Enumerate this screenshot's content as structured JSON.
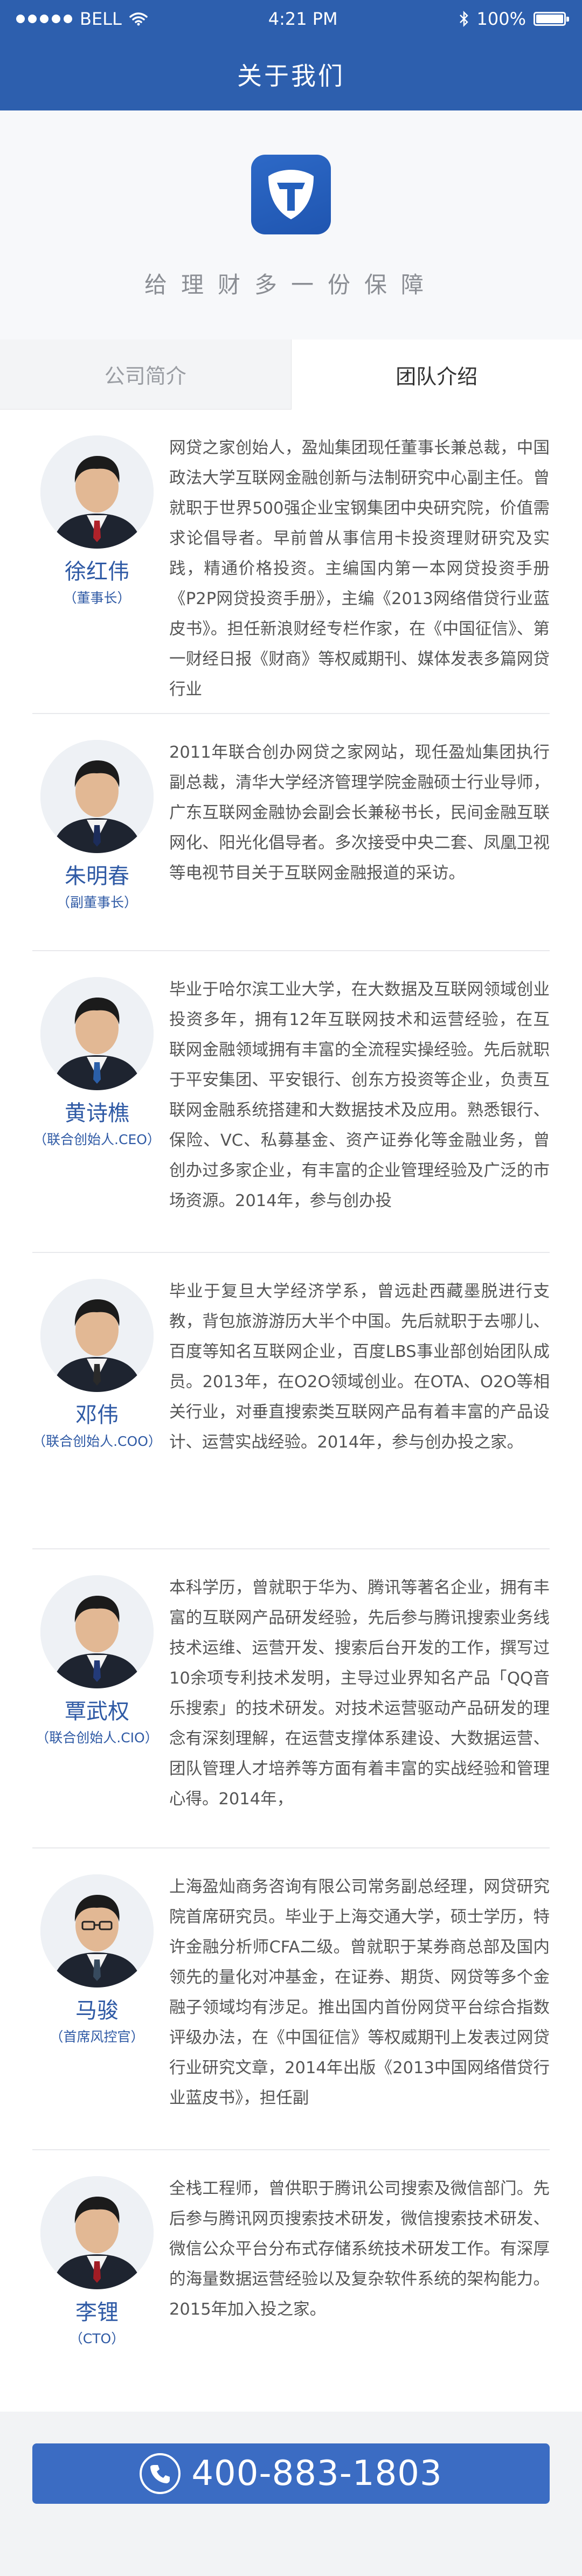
{
  "status_bar": {
    "carrier": "BELL",
    "time": "4:21 PM",
    "battery": "100%",
    "battery_level": 1.0
  },
  "header": {
    "title": "关于我们"
  },
  "hero": {
    "slogan": "给理财多一份保障"
  },
  "tabs": [
    {
      "label": "公司简介",
      "active": false
    },
    {
      "label": "团队介绍",
      "active": true
    }
  ],
  "members": [
    {
      "name": "徐红伟",
      "title": "（董事长）",
      "bio": "网贷之家创始人，盈灿集团现任董事长兼总裁，中国政法大学互联网金融创新与法制研究中心副主任。曾就职于世界500强企业宝钢集团中央研究院，价值需求论倡导者。早前曾从事信用卡投资理财研究及实践，精通价格投资。主编国内第一本网贷投资手册《P2P网贷投资手册》，主编《2013网络借贷行业蓝皮书》。担任新浪财经专栏作家，在《中国征信》、第一财经日报《财商》等权威期刊、媒体发表多篇网贷行业"
    },
    {
      "name": "朱明春",
      "title": "（副董事长）",
      "bio": "2011年联合创办网贷之家网站，现任盈灿集团执行副总裁，清华大学经济管理学院金融硕士行业导师，广东互联网金融协会副会长兼秘书长，民间金融互联网化、阳光化倡导者。多次接受中央二套、凤凰卫视等电视节目关于互联网金融报道的采访。"
    },
    {
      "name": "黄诗樵",
      "title": "（联合创始人.CEO）",
      "bio": "毕业于哈尔滨工业大学，在大数据及互联网领域创业投资多年，拥有12年互联网技术和运营经验，在互联网金融领域拥有丰富的全流程实操经验。先后就职于平安集团、平安银行、创东方投资等企业，负责互联网金融系统搭建和大数据技术及应用。熟悉银行、保险、VC、私募基金、资产证券化等金融业务，曾创办过多家企业，有丰富的企业管理经验及广泛的市场资源。2014年，参与创办投"
    },
    {
      "name": "邓伟",
      "title": "（联合创始人.COO）",
      "bio": "毕业于复旦大学经济学系，曾远赴西藏墨脱进行支教，背包旅游游历大半个中国。先后就职于去哪儿、百度等知名互联网企业，百度LBS事业部创始团队成员。2013年，在O2O领域创业。在OTA、O2O等相关行业，对垂直搜索类互联网产品有着丰富的产品设计、运营实战经验。2014年，参与创办投之家。"
    },
    {
      "name": "覃武权",
      "title": "（联合创始人.CIO）",
      "bio": "本科学历，曾就职于华为、腾讯等著名企业，拥有丰富的互联网产品研发经验，先后参与腾讯搜索业务线技术运维、运营开发、搜索后台开发的工作，撰写过10余项专利技术发明，主导过业界知名产品「QQ音乐搜索」的技术研发。对技术运营驱动产品研发的理念有深刻理解，在运营支撑体系建设、大数据运营、团队管理人才培养等方面有着丰富的实战经验和管理心得。2014年，"
    },
    {
      "name": "马骏",
      "title": "（首席风控官）",
      "bio": "上海盈灿商务咨询有限公司常务副总经理，网贷研究院首席研究员。毕业于上海交通大学，硕士学历，特许金融分析师CFA二级。曾就职于某券商总部及国内领先的量化对冲基金，在证券、期货、网贷等多个金融子领域均有涉足。推出国内首份网贷平台综合指数评级办法，在《中国征信》等权威期刊上发表过网贷行业研究文章，2014年出版《2013中国网络借贷行业蓝皮书》，担任副"
    },
    {
      "name": "李锂",
      "title": "（CTO）",
      "bio": "全栈工程师，曾供职于腾讯公司搜索及微信部门。先后参与腾讯网页搜索技术研发，微信搜索技术研发、微信公众平台分布式存储系统技术研发工作。有深厚的海量数据运营经验以及复杂软件系统的架构能力。2015年加入投之家。"
    }
  ],
  "footer": {
    "phone": "400-883-1803"
  },
  "colors": {
    "primary": "#2d5fae",
    "accent": "#3b6cc3",
    "name_color": "#2f5aa5"
  }
}
